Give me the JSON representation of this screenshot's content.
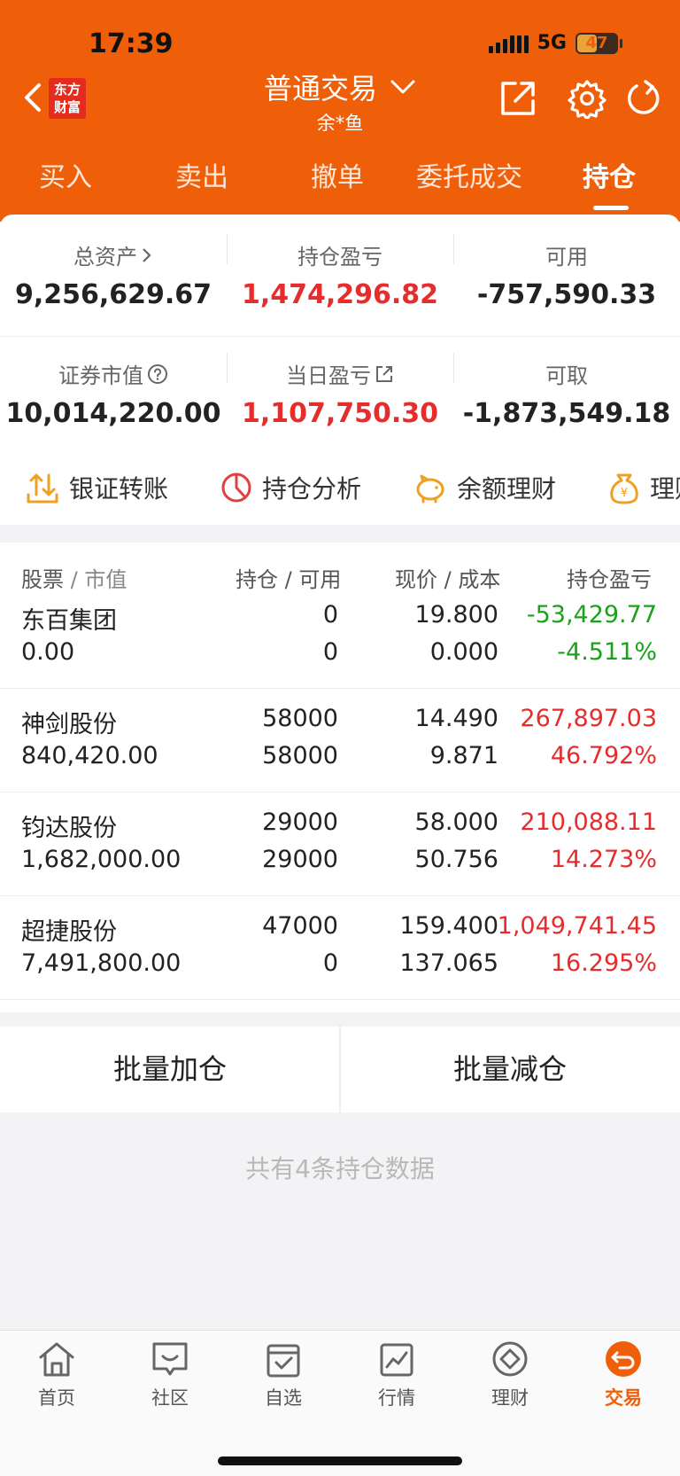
{
  "status": {
    "time": "17:39",
    "network": "5G",
    "battery": "47"
  },
  "header": {
    "logo_line1": "东方",
    "logo_line2": "财富",
    "title": "普通交易",
    "subtitle": "余*鱼",
    "tabs": [
      "买入",
      "卖出",
      "撤单",
      "委托成交",
      "持仓"
    ]
  },
  "summary": {
    "total_assets": {
      "label": "总资产",
      "value": "9,256,629.67"
    },
    "position_pnl": {
      "label": "持仓盈亏",
      "value": "1,474,296.82"
    },
    "available": {
      "label": "可用",
      "value": "-757,590.33"
    },
    "market_value": {
      "label": "证券市值",
      "value": "10,014,220.00"
    },
    "daily_pnl": {
      "label": "当日盈亏",
      "value": "1,107,750.30"
    },
    "withdrawable": {
      "label": "可取",
      "value": "-1,873,549.18"
    }
  },
  "quick_actions": [
    "银证转账",
    "持仓分析",
    "余额理财",
    "理财"
  ],
  "table": {
    "headers": {
      "stock": "股票",
      "market": "市值",
      "hold": "持仓",
      "avail": "可用",
      "price": "现价",
      "cost": "成本",
      "pnl": "持仓盈亏"
    },
    "rows": [
      {
        "name": "东百集团",
        "mv": "0.00",
        "hold": "0",
        "avail": "0",
        "price": "19.800",
        "cost": "0.000",
        "pnl": "-53,429.77",
        "pct": "-4.511%"
      },
      {
        "name": "神剑股份",
        "mv": "840,420.00",
        "hold": "58000",
        "avail": "58000",
        "price": "14.490",
        "cost": "9.871",
        "pnl": "267,897.03",
        "pct": "46.792%"
      },
      {
        "name": "钧达股份",
        "mv": "1,682,000.00",
        "hold": "29000",
        "avail": "29000",
        "price": "58.000",
        "cost": "50.756",
        "pnl": "210,088.11",
        "pct": "14.273%"
      },
      {
        "name": "超捷股份",
        "mv": "7,491,800.00",
        "hold": "47000",
        "avail": "0",
        "price": "159.400",
        "cost": "137.065",
        "pnl": "1,049,741.45",
        "pct": "16.295%"
      }
    ]
  },
  "batch": {
    "add": "批量加仓",
    "reduce": "批量减仓"
  },
  "footer_note": "共有4条持仓数据",
  "nav": [
    "首页",
    "社区",
    "自选",
    "行情",
    "理财",
    "交易"
  ],
  "colors": {
    "brand": "#ef5f0a",
    "up": "#e52d2d",
    "down": "#1aa31a"
  }
}
